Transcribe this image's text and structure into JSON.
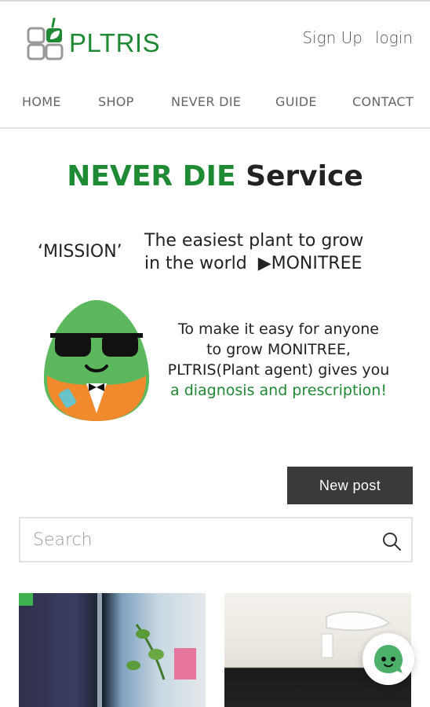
{
  "header": {
    "brand": "PLTRIS",
    "sign_up": "Sign Up",
    "login": "login"
  },
  "nav": {
    "items": [
      "HOME",
      "SHOP",
      "NEVER DIE",
      "GUIDE",
      "CONTACT"
    ]
  },
  "title": {
    "accent": "NEVER DIE",
    "rest": " Service"
  },
  "mission": {
    "label": "‘MISSION’",
    "line1": "The easiest plant to grow",
    "line2": "in the world  ▶MONITREE"
  },
  "description": {
    "line1": "To make it easy for anyone",
    "line2": "to grow MONITREE,",
    "line3": "PLTRIS(Plant agent) gives you",
    "line4": "a diagnosis and prescription!"
  },
  "actions": {
    "new_post": "New post"
  },
  "search": {
    "placeholder": "Search",
    "value": ""
  },
  "colors": {
    "brand_green": "#1f8a34",
    "button_dark": "#3a3a3a"
  },
  "icons": [
    "pltris-logo-icon",
    "search-icon",
    "chat-mascot-icon"
  ]
}
